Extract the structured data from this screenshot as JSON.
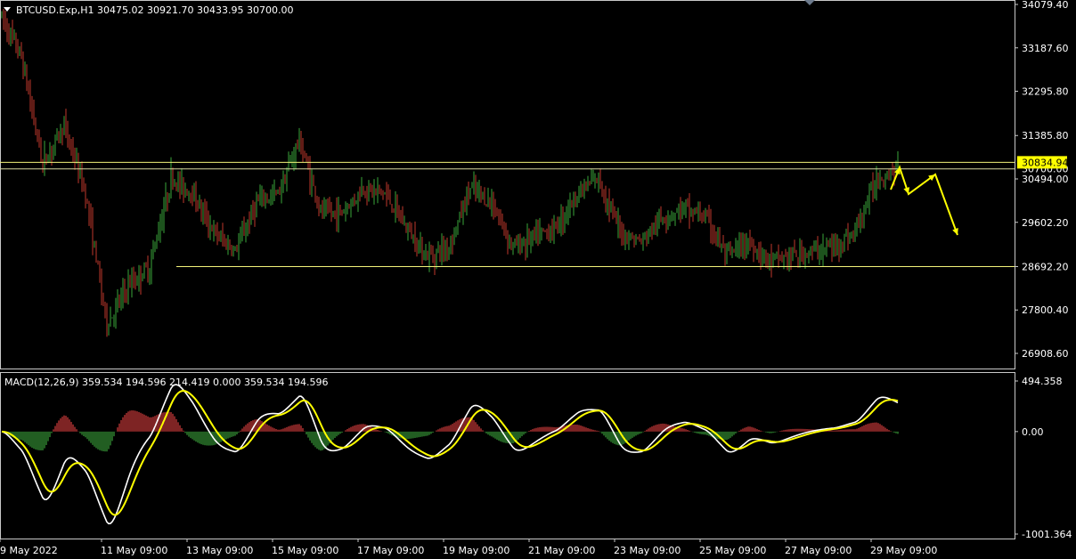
{
  "window": {
    "symbol_info": "BTCUSD.Exp,H1  30475.02 30921.70 30433.95 30700.00",
    "macd_info": "MACD(12,26,9) 359.534 194.596 214.419 0.000 359.534 194.596"
  },
  "colors": {
    "background": "#000000",
    "bull_candle": "#3aa63a",
    "bear_candle": "#c0392b",
    "level_line": "#f2f27a",
    "arrow": "#ffff00",
    "macd_line": "#ffffff",
    "signal_line": "#ffff00"
  },
  "price_axis": {
    "ticks": [
      "34079.40",
      "33187.60",
      "32295.80",
      "31385.80",
      "30494.00",
      "29602.20",
      "28692.20",
      "27800.40",
      "26908.60"
    ],
    "current_price_label": "30834.94",
    "hidden_label": "30700.00"
  },
  "macd_axis": {
    "ticks": [
      "494.358",
      "0.00",
      "-1001.364"
    ]
  },
  "time_axis": {
    "labels": [
      "9 May 2022",
      "11 May 09:00",
      "13 May 09:00",
      "15 May 09:00",
      "17 May 09:00",
      "19 May 09:00",
      "21 May 09:00",
      "23 May 09:00",
      "25 May 09:00",
      "27 May 09:00",
      "29 May 09:00"
    ]
  },
  "chart_data": [
    {
      "type": "candlestick",
      "symbol": "BTCUSD.Exp",
      "timeframe": "H1",
      "last_bar": {
        "open": 30475.02,
        "high": 30921.7,
        "low": 30433.95,
        "close": 30700.0
      },
      "ylim": [
        26600,
        34100
      ],
      "x_range": [
        "9 May 2022",
        "30 May 2022"
      ],
      "horizontal_levels": [
        30834.94,
        30700.0,
        28692.2
      ],
      "price_path": [
        [
          "9 May 2022",
          33900
        ],
        [
          "9 May 12:00",
          33000
        ],
        [
          "10 May 00:00",
          30800
        ],
        [
          "10 May 12:00",
          31600
        ],
        [
          "11 May 00:00",
          30200
        ],
        [
          "11 May 12:00",
          27500
        ],
        [
          "12 May 00:00",
          28300
        ],
        [
          "12 May 12:00",
          28700
        ],
        [
          "13 May 00:00",
          30500
        ],
        [
          "13 May 12:00",
          30200
        ],
        [
          "14 May 00:00",
          29400
        ],
        [
          "14 May 12:00",
          29000
        ],
        [
          "15 May 00:00",
          30000
        ],
        [
          "15 May 12:00",
          30200
        ],
        [
          "16 May 00:00",
          31300
        ],
        [
          "16 May 12:00",
          29800
        ],
        [
          "17 May 00:00",
          29800
        ],
        [
          "17 May 12:00",
          30300
        ],
        [
          "18 May 00:00",
          30200
        ],
        [
          "18 May 12:00",
          29500
        ],
        [
          "19 May 00:00",
          28900
        ],
        [
          "19 May 12:00",
          29100
        ],
        [
          "20 May 00:00",
          30300
        ],
        [
          "20 May 12:00",
          30000
        ],
        [
          "21 May 00:00",
          29100
        ],
        [
          "21 May 12:00",
          29300
        ],
        [
          "22 May 00:00",
          29500
        ],
        [
          "22 May 12:00",
          30200
        ],
        [
          "23 May 00:00",
          30500
        ],
        [
          "23 May 12:00",
          29400
        ],
        [
          "24 May 00:00",
          29200
        ],
        [
          "24 May 12:00",
          29700
        ],
        [
          "25 May 00:00",
          29900
        ],
        [
          "25 May 12:00",
          29700
        ],
        [
          "26 May 00:00",
          28900
        ],
        [
          "26 May 12:00",
          29200
        ],
        [
          "27 May 00:00",
          28800
        ],
        [
          "27 May 12:00",
          28900
        ],
        [
          "28 May 00:00",
          29000
        ],
        [
          "28 May 12:00",
          29100
        ],
        [
          "29 May 00:00",
          29400
        ],
        [
          "29 May 12:00",
          30500
        ],
        [
          "30 May 00:00",
          30700
        ]
      ]
    },
    {
      "type": "macd",
      "params": [
        12,
        26,
        9
      ],
      "values": {
        "main": 359.534,
        "signal": 194.596,
        "histogram": 214.419
      },
      "ylim": [
        -1001.364,
        494.358
      ]
    }
  ]
}
